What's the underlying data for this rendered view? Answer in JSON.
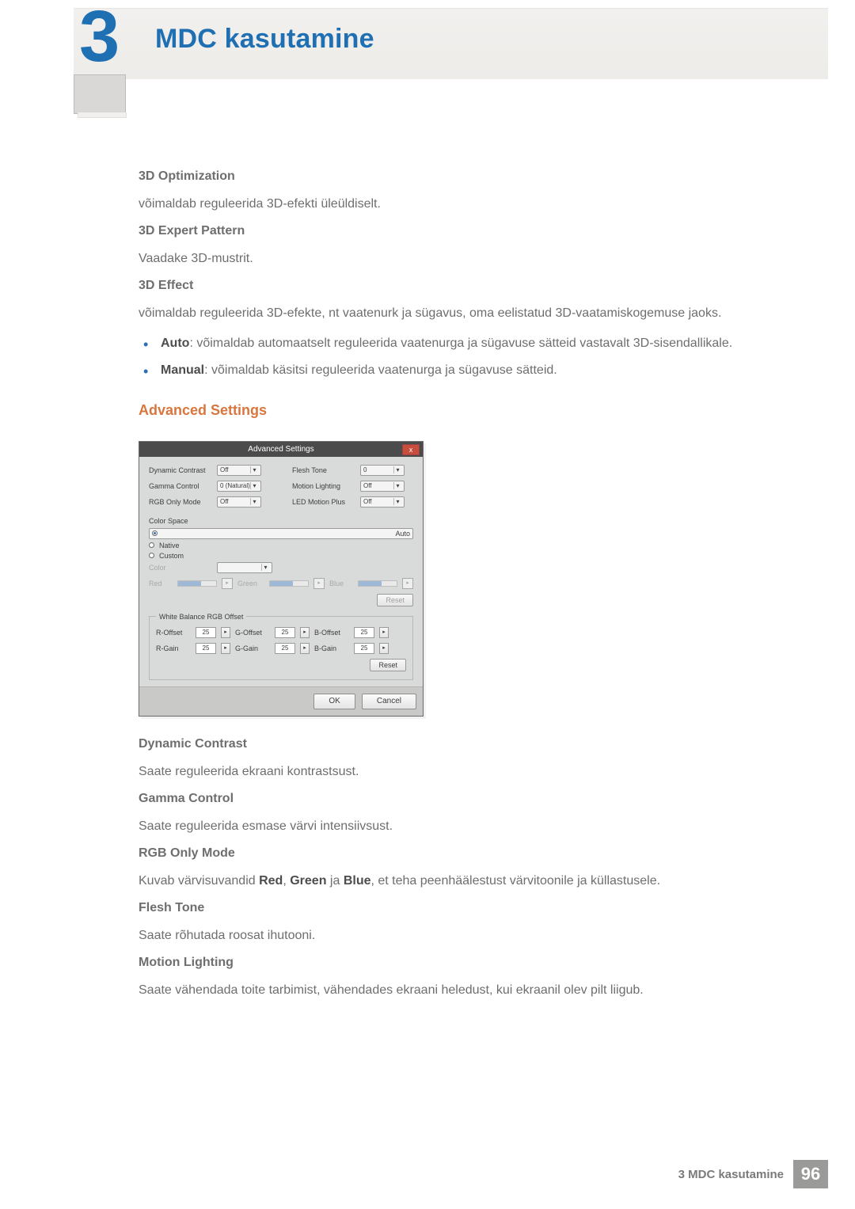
{
  "header": {
    "chapter_number": "3",
    "title": "MDC kasutamine"
  },
  "s3dopt": {
    "title": "3D Optimization",
    "text": "võimaldab reguleerida 3D-efekti üleüldiselt."
  },
  "s3dexp": {
    "title": "3D Expert Pattern",
    "text": "Vaadake 3D-mustrit."
  },
  "s3deff": {
    "title": "3D Effect",
    "text": "võimaldab reguleerida 3D-efekte, nt vaatenurk ja sügavus, oma eelistatud 3D-vaatamiskogemuse jaoks.",
    "auto_label": "Auto",
    "auto_text": ": võimaldab automaatselt reguleerida vaatenurga ja sügavuse sätteid vastavalt 3D-sisendallikale.",
    "manual_label": "Manual",
    "manual_text": ": võimaldab käsitsi reguleerida vaatenurga ja sügavuse sätteid."
  },
  "adv": {
    "title": "Advanced Settings"
  },
  "dialog": {
    "title": "Advanced Settings",
    "close": "x",
    "left": {
      "dynamic_contrast": {
        "label": "Dynamic Contrast",
        "value": "Off"
      },
      "gamma_control": {
        "label": "Gamma Control",
        "value": "0 (Natural)"
      },
      "rgb_only": {
        "label": "RGB Only Mode",
        "value": "Off"
      }
    },
    "right": {
      "flesh_tone": {
        "label": "Flesh Tone",
        "value": "0"
      },
      "motion_light": {
        "label": "Motion Lighting",
        "value": "Off"
      },
      "led_motion": {
        "label": "LED Motion Plus",
        "value": "Off"
      }
    },
    "color_space": {
      "group": "Color Space",
      "auto": "Auto",
      "native": "Native",
      "custom": "Custom",
      "color_lbl": "Color",
      "sliders": {
        "red": "Red",
        "green": "Green",
        "blue": "Blue"
      },
      "reset": "Reset"
    },
    "wb": {
      "legend": "White Balance RGB Offset",
      "r_offset": {
        "label": "R-Offset",
        "value": "25"
      },
      "g_offset": {
        "label": "G-Offset",
        "value": "25"
      },
      "b_offset": {
        "label": "B-Offset",
        "value": "25"
      },
      "r_gain": {
        "label": "R-Gain",
        "value": "25"
      },
      "g_gain": {
        "label": "G-Gain",
        "value": "25"
      },
      "b_gain": {
        "label": "B-Gain",
        "value": "25"
      },
      "reset": "Reset"
    },
    "ok": "OK",
    "cancel": "Cancel"
  },
  "dyn": {
    "title": "Dynamic Contrast",
    "text": "Saate reguleerida ekraani kontrastsust."
  },
  "gamma": {
    "title": "Gamma Control",
    "text": "Saate reguleerida esmase värvi intensiivsust."
  },
  "rgb": {
    "title": "RGB Only Mode",
    "pre": "Kuvab värvisuvandid ",
    "red": "Red",
    "comma1": ", ",
    "green": "Green",
    "and": " ja ",
    "blue": "Blue",
    "post": ", et teha peenhäälestust värvitoonile ja küllastusele."
  },
  "flesh": {
    "title": "Flesh Tone",
    "text": "Saate rõhutada roosat ihutooni."
  },
  "motion": {
    "title": "Motion Lighting",
    "text": "Saate vähendada toite tarbimist, vähendades ekraani heledust, kui ekraanil olev pilt liigub."
  },
  "footer": {
    "text": "3 MDC kasutamine",
    "page": "96"
  }
}
